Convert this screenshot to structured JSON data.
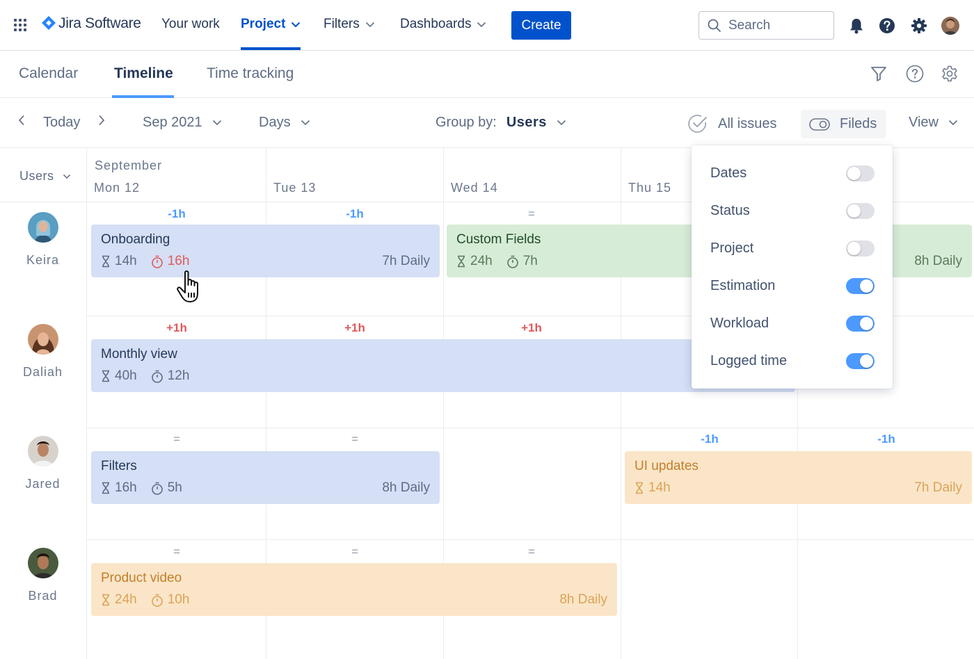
{
  "app": {
    "logo_text": "Jira Software",
    "accent_color": "#0052cc"
  },
  "topnav": {
    "items": [
      {
        "label": "Your work",
        "active": false,
        "dropdown": false
      },
      {
        "label": "Project",
        "active": true,
        "dropdown": true
      },
      {
        "label": "Filters",
        "active": false,
        "dropdown": true
      },
      {
        "label": "Dashboards",
        "active": false,
        "dropdown": true
      }
    ],
    "create_label": "Create",
    "search_placeholder": "Search",
    "icons": [
      "app-switcher-icon",
      "notifications-icon",
      "help-icon",
      "settings-icon",
      "user-avatar"
    ]
  },
  "tabs": {
    "items": [
      {
        "label": "Calendar",
        "active": false
      },
      {
        "label": "Timeline",
        "active": true
      },
      {
        "label": "Time tracking",
        "active": false
      }
    ],
    "icons": [
      "filter-icon",
      "help-icon",
      "settings-icon"
    ]
  },
  "toolbar": {
    "today_label": "Today",
    "month_label": "Sep 2021",
    "scale_label": "Days",
    "group_by_label": "Group by:",
    "group_by_value": "Users",
    "all_issues_label": "All issues",
    "fields_label": "Fileds",
    "view_label": "View"
  },
  "grid": {
    "users_header": "Users",
    "month": "September",
    "days": [
      "Mon 12",
      "Tue 13",
      "Wed 14",
      "Thu 15"
    ],
    "users": [
      {
        "name": "Keira",
        "workload": [
          "-1h",
          "-1h",
          "="
        ]
      },
      {
        "name": "Daliah",
        "workload": [
          "+1h",
          "+1h",
          "+1h"
        ]
      },
      {
        "name": "Jared",
        "workload": [
          "=",
          "=",
          "-1h",
          "-1h"
        ]
      },
      {
        "name": "Brad",
        "workload": [
          "=",
          "=",
          "="
        ]
      }
    ],
    "tasks": [
      {
        "title": "Onboarding",
        "estimate": "14h",
        "logged": "16h",
        "logged_over": true,
        "daily": "7h Daily",
        "color": "#d5dff5"
      },
      {
        "title": "Custom Fields",
        "estimate": "24h",
        "logged": "7h",
        "daily": "8h Daily",
        "color": "#d7ecd7"
      },
      {
        "title": "Monthly view",
        "estimate": "40h",
        "logged": "12h",
        "color": "#d5dff5"
      },
      {
        "title": "Filters",
        "estimate": "16h",
        "logged": "5h",
        "daily": "8h Daily",
        "color": "#d5dff5"
      },
      {
        "title": "UI updates",
        "estimate": "14h",
        "daily": "7h Daily",
        "color": "#fbe5c8"
      },
      {
        "title": "Product video",
        "estimate": "24h",
        "logged": "10h",
        "daily": "8h Daily",
        "color": "#fbe5c8"
      }
    ]
  },
  "fields_menu": {
    "items": [
      {
        "label": "Dates",
        "enabled": false
      },
      {
        "label": "Status",
        "enabled": false
      },
      {
        "label": "Project",
        "enabled": false
      },
      {
        "label": "Estimation",
        "enabled": true
      },
      {
        "label": "Workload",
        "enabled": true
      },
      {
        "label": "Logged time",
        "enabled": true
      }
    ]
  }
}
